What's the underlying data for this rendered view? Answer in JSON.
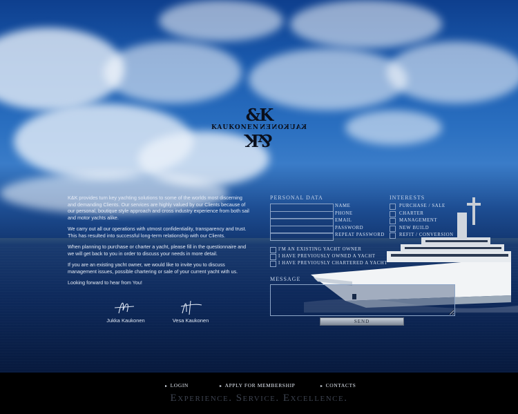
{
  "brand": {
    "logo_text": "KAUKONEN",
    "logo_monogram": "&K"
  },
  "intro": {
    "paragraphs": [
      "K&K provides turn key yachting solutions to some of the worlds most discerning and demanding Clients. Our services are highly valued by our Clients because of our personal, boutique style approach and cross industry experience from both sail and motor yachts alike.",
      "We carry out all our operations with utmost confidentiality, transparency and trust. This has resulted into successful long-term relationship with our Clients.",
      "When planning to purchase or charter a yacht, please fill in the questionnaire and we will get back to you in order to discuss your needs in more detail.",
      "If you are an existing yacht owner, we would like to invite you to discuss management issues, possible chartering or sale of your current yacht with us.",
      "Looking forward to hear from You!"
    ]
  },
  "signatures": [
    {
      "name": "Jukka Kaukonen"
    },
    {
      "name": "Vesa Kaukonen"
    }
  ],
  "form": {
    "personal_title": "Personal Data",
    "fields": [
      {
        "label": "Name",
        "value": ""
      },
      {
        "label": "Phone",
        "value": ""
      },
      {
        "label": "Email",
        "value": ""
      },
      {
        "label": "Password",
        "value": ""
      },
      {
        "label": "Repeat Password",
        "value": ""
      }
    ],
    "interests_title": "Interests",
    "interests": [
      {
        "label": "Purchase / Sale",
        "checked": false
      },
      {
        "label": "Charter",
        "checked": false
      },
      {
        "label": "Management",
        "checked": false
      },
      {
        "label": "New Build",
        "checked": false
      },
      {
        "label": "Refit / Conversion",
        "checked": false
      }
    ],
    "ownership": [
      {
        "label": "I'm an existing yacht owner",
        "checked": false
      },
      {
        "label": "I have previously owned a yacht",
        "checked": false
      },
      {
        "label": "I have previously chartered a yacht",
        "checked": false
      }
    ],
    "message_title": "Message",
    "message_value": "",
    "send_label": "Send"
  },
  "footer": {
    "nav": [
      {
        "label": "LOGIN"
      },
      {
        "label": "APPLY FOR MEMBERSHIP"
      },
      {
        "label": "CONTACTS"
      }
    ],
    "tagline": "Experience.  Service.  Excellence."
  }
}
